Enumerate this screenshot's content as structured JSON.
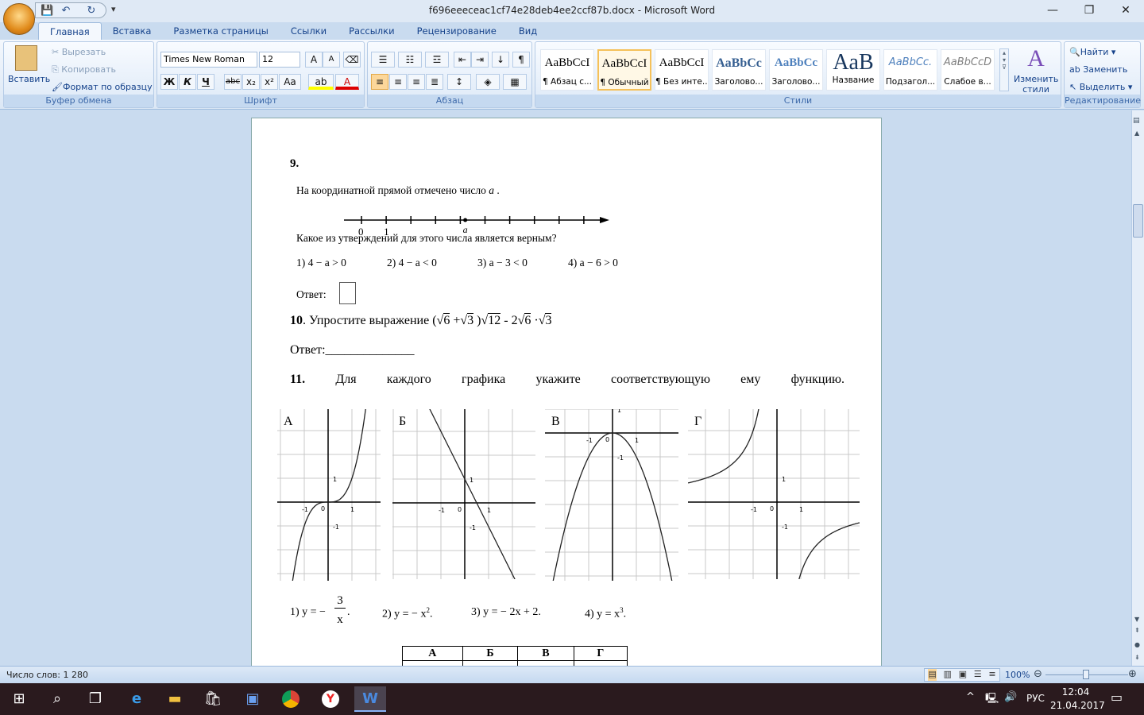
{
  "window": {
    "title": "f696eeeceac1cf74e28deb4ee2ccf87b.docx - Microsoft Word"
  },
  "tabs": [
    "Главная",
    "Вставка",
    "Разметка страницы",
    "Ссылки",
    "Рассылки",
    "Рецензирование",
    "Вид"
  ],
  "clipboard": {
    "paste": "Вставить",
    "cut": "Вырезать",
    "copy": "Копировать",
    "format_painter": "Формат по образцу",
    "label": "Буфер обмена"
  },
  "font": {
    "name": "Times New Roman",
    "size": "12",
    "label": "Шрифт",
    "bold": "Ж",
    "italic": "К",
    "underline": "Ч",
    "strike": "abc",
    "sub": "x₂",
    "sup": "x²",
    "case": "Aa"
  },
  "paragraph": {
    "label": "Абзац"
  },
  "styles": {
    "label": "Стили",
    "items": [
      {
        "preview": "AaBbCcI",
        "name": "¶ Абзац с..."
      },
      {
        "preview": "AaBbCcI",
        "name": "¶ Обычный",
        "selected": true
      },
      {
        "preview": "AaBbCcI",
        "name": "¶ Без инте..."
      },
      {
        "preview": "AaBbCc",
        "name": "Заголово..."
      },
      {
        "preview": "AaBbCc",
        "name": "Заголово..."
      },
      {
        "preview": "AaB",
        "name": "Название"
      },
      {
        "preview": "AaBbCc.",
        "name": "Подзагол..."
      },
      {
        "preview": "AaBbCcD",
        "name": "Слабое в..."
      }
    ],
    "change": "Изменить стили"
  },
  "editing": {
    "find": "Найти",
    "replace": "Заменить",
    "select": "Выделить",
    "label": "Редактирование"
  },
  "doc": {
    "q9": {
      "num": "9.",
      "text": "На координатной прямой отмечено число",
      "var": "a",
      "numberline": {
        "labels": [
          "0",
          "1",
          "a"
        ],
        "ticks": 10,
        "a_value": 4.2
      },
      "question": "Какое из утверждений для этого числа является верным?",
      "options": [
        "1)  4 − a > 0",
        "2)  4 − a < 0",
        "3)  a − 3 < 0",
        "4)  a − 6 > 0"
      ],
      "answer_label": "Ответ:"
    },
    "q10": {
      "num": "10",
      "text": ". Упростите выражение",
      "answer_label": "Ответ:______________"
    },
    "q11": {
      "num": "11.",
      "words": [
        "Для",
        "каждого",
        "графика",
        "укажите",
        "соответствующую",
        "ему",
        "функцию."
      ],
      "graphs": [
        {
          "label": "А",
          "curve": "y = x^3"
        },
        {
          "label": "Б",
          "curve": "y = -2x + 1"
        },
        {
          "label": "В",
          "curve": "y = -x^2"
        },
        {
          "label": "Г",
          "curve": "y = -3/x"
        }
      ],
      "tick_labels": {
        "zero": "0",
        "one": "1",
        "minus_one": "-1"
      },
      "functions": [
        "1) y = −",
        "3",
        "x",
        ".",
        "2) y = − x",
        "2",
        ".",
        "3) y = − 2x + 2.",
        "4) y = x",
        "3",
        "."
      ],
      "table_headers": [
        "А",
        "Б",
        "В",
        "Г"
      ]
    }
  },
  "status": {
    "words": "Число слов: 1 280",
    "zoom": "100%"
  },
  "taskbar": {
    "lang": "РУС",
    "time": "12:04",
    "date": "21.04.2017"
  }
}
